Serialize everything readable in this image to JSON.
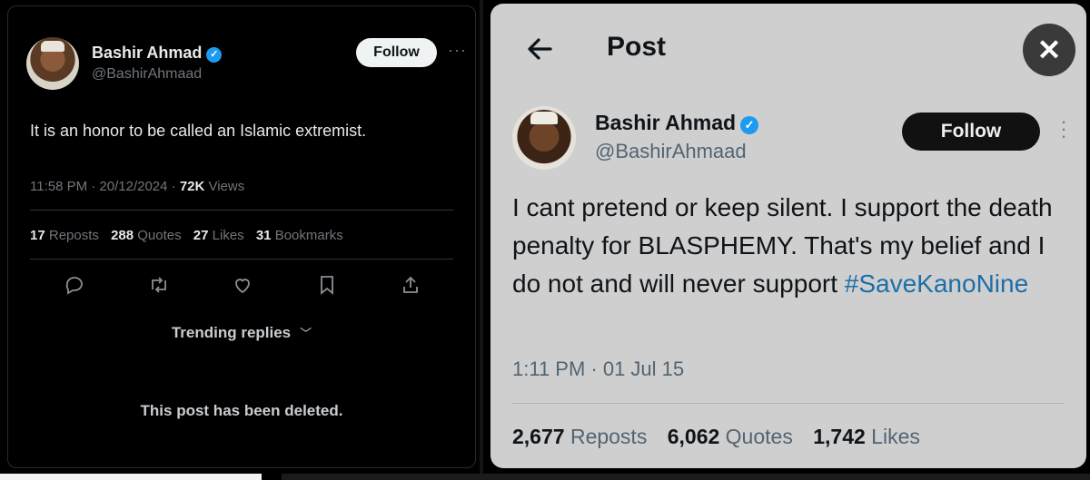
{
  "left_post": {
    "author_name": "Bashir Ahmad",
    "handle": "@BashirAhmaad",
    "follow_label": "Follow",
    "more_label": "···",
    "text": "It is an honor to be called an Islamic extremist.",
    "time": "11:58 PM · 20/12/2024 · ",
    "views_count": "72K",
    "views_label": " Views",
    "stats": [
      {
        "count": "17",
        "label": " Reposts"
      },
      {
        "count": "288",
        "label": " Quotes"
      },
      {
        "count": "27",
        "label": " Likes"
      },
      {
        "count": "31",
        "label": " Bookmarks"
      }
    ],
    "actions": [
      "reply-icon",
      "repost-icon",
      "like-icon",
      "bookmark-icon",
      "share-icon"
    ],
    "trending_label": "Trending replies",
    "deleted_notice": "This post has been deleted."
  },
  "right_post": {
    "header_title": "Post",
    "close_label": "✕",
    "author_name": "Bashir Ahmad",
    "handle": "@BashirAhmaad",
    "follow_label": "Follow",
    "more_label": "⋮",
    "text": "I cant pretend or keep silent. I support the death penalty for BLASPHEMY. That's my belief and I do not and will never support ",
    "hashtag": "#SaveKanoNine",
    "time": "1:11 PM · 01 Jul 15",
    "stats": [
      {
        "count": "2,677",
        "label": " Reposts"
      },
      {
        "count": "6,062",
        "label": " Quotes"
      },
      {
        "count": "1,742",
        "label": " Likes"
      }
    ]
  },
  "colors": {
    "verified_badge": "#1d9bf0",
    "hashtag": "#1d6fa8",
    "dark_bg": "#000000",
    "light_bg": "#cfcfcf"
  }
}
